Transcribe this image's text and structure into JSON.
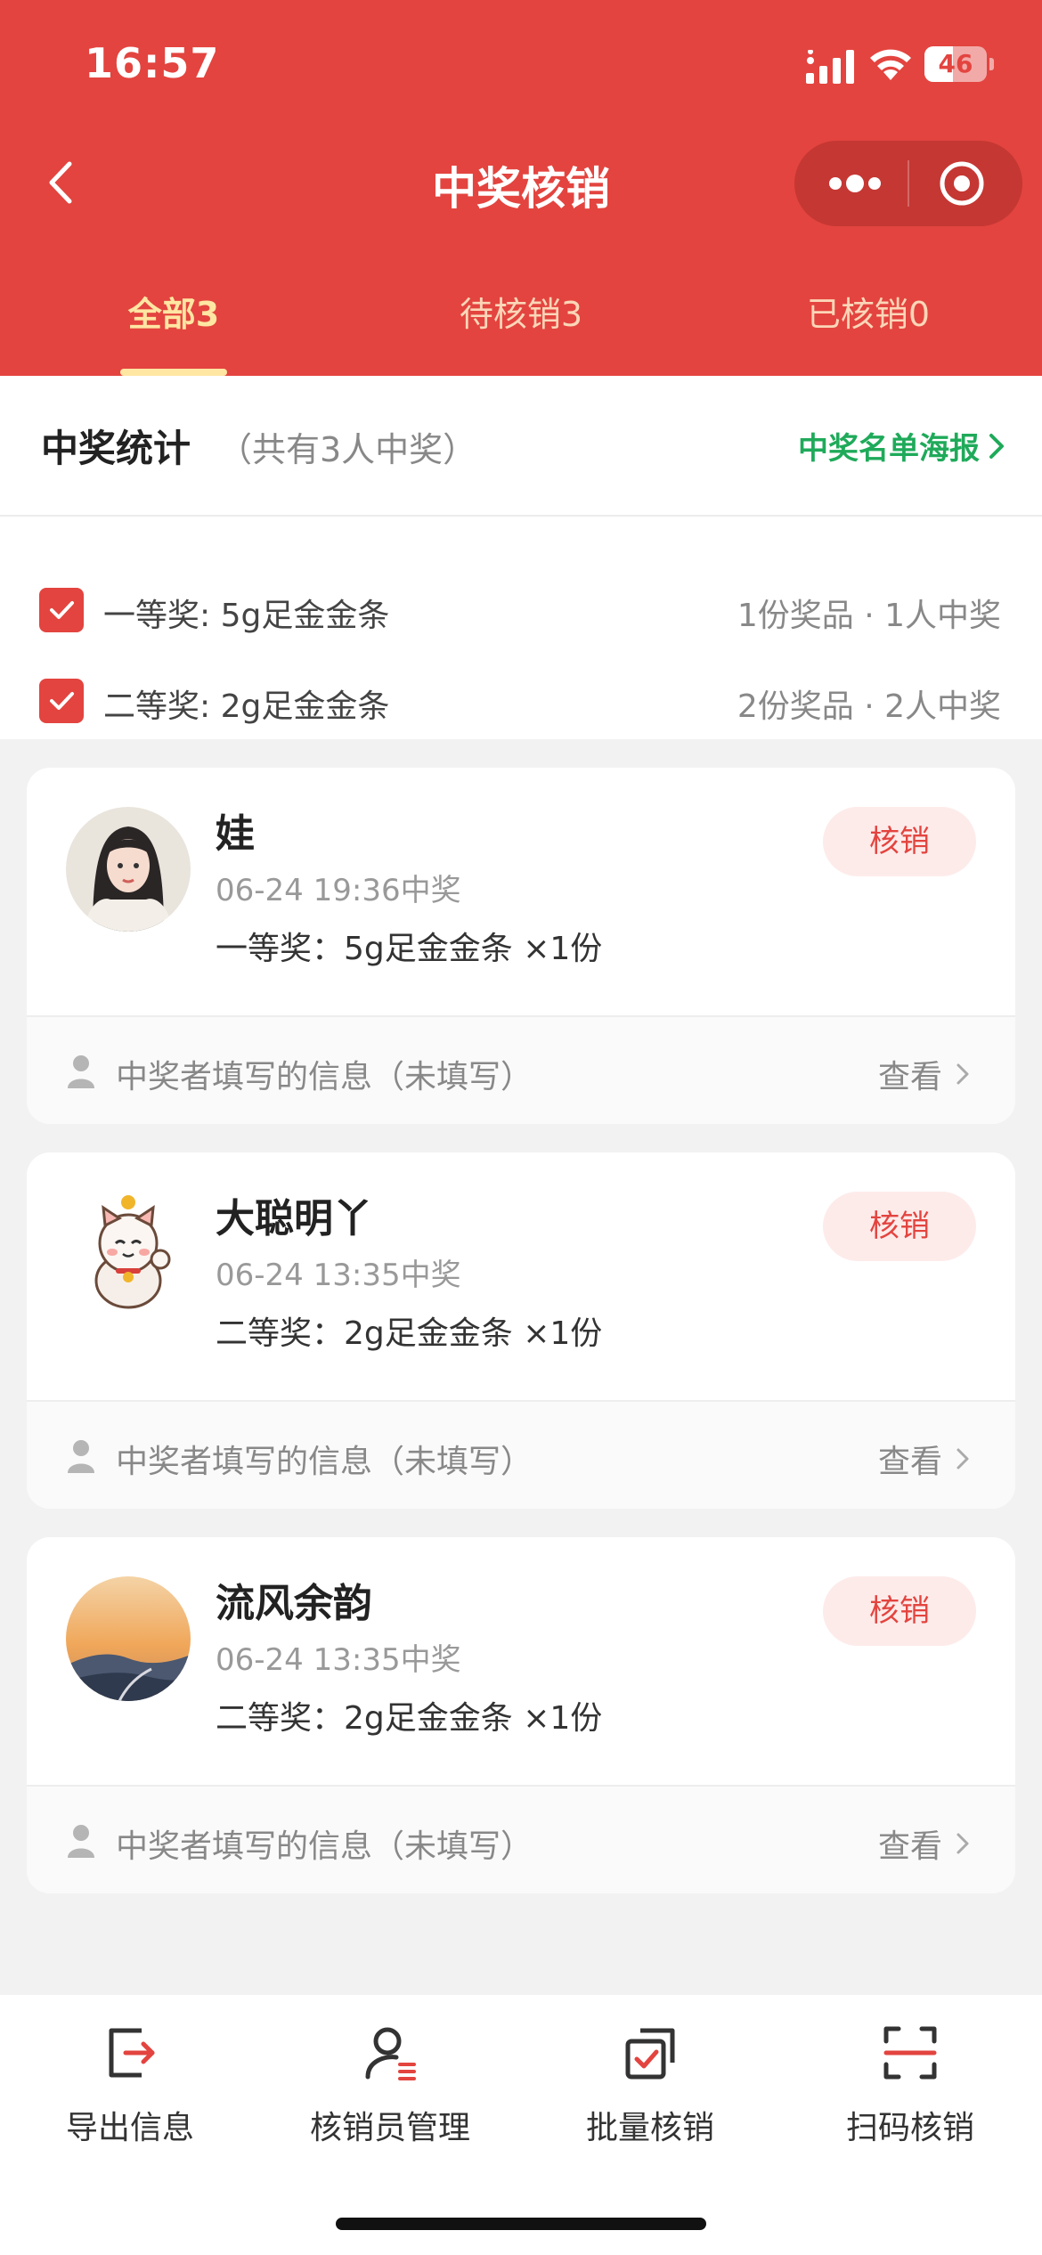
{
  "status_bar": {
    "time": "16:57",
    "battery_level": "46",
    "battery_fraction": 0.46,
    "icons": [
      "signal-icon",
      "wifi-icon",
      "battery-icon"
    ]
  },
  "nav": {
    "title": "中奖核销",
    "back_icon": "chevron-left-icon",
    "more_icon": "more-dots-icon",
    "close_icon": "target-close-icon"
  },
  "tabs": [
    {
      "label": "全部3",
      "active": true
    },
    {
      "label": "待核销3",
      "active": false
    },
    {
      "label": "已核销0",
      "active": false
    }
  ],
  "stats": {
    "title": "中奖统计",
    "subtitle": "（共有3人中奖）",
    "poster_link": "中奖名单海报",
    "prizes": [
      {
        "name": "一等奖: 5g足金金条",
        "count": "1份奖品 · 1人中奖",
        "checked": true
      },
      {
        "name": "二等奖: 2g足金金条",
        "count": "2份奖品 · 2人中奖",
        "checked": true
      }
    ]
  },
  "winners": [
    {
      "name": "娃",
      "time": "06-24 19:36中奖",
      "prize": "一等奖：5g足金金条 ×1份",
      "button": "核销",
      "info_label": "中奖者填写的信息（未填写）",
      "view_label": "查看",
      "avatar": "girl-portrait-avatar"
    },
    {
      "name": "大聪明丫",
      "time": "06-24 13:35中奖",
      "prize": "二等奖：2g足金金条 ×1份",
      "button": "核销",
      "info_label": "中奖者填写的信息（未填写）",
      "view_label": "查看",
      "avatar": "lucky-cat-avatar"
    },
    {
      "name": "流风余韵",
      "time": "06-24 13:35中奖",
      "prize": "二等奖：2g足金金条 ×1份",
      "button": "核销",
      "info_label": "中奖者填写的信息（未填写）",
      "view_label": "查看",
      "avatar": "sunset-landscape-avatar"
    }
  ],
  "bottom_bar": [
    {
      "label": "导出信息",
      "icon": "export-icon"
    },
    {
      "label": "核销员管理",
      "icon": "staff-manage-icon"
    },
    {
      "label": "批量核销",
      "icon": "batch-redeem-icon"
    },
    {
      "label": "扫码核销",
      "icon": "scan-code-icon"
    }
  ],
  "colors": {
    "brand_red": "#e3443f",
    "tab_active": "#ffe6a3",
    "link_green": "#1faa5a",
    "button_bg": "#fdebea"
  }
}
